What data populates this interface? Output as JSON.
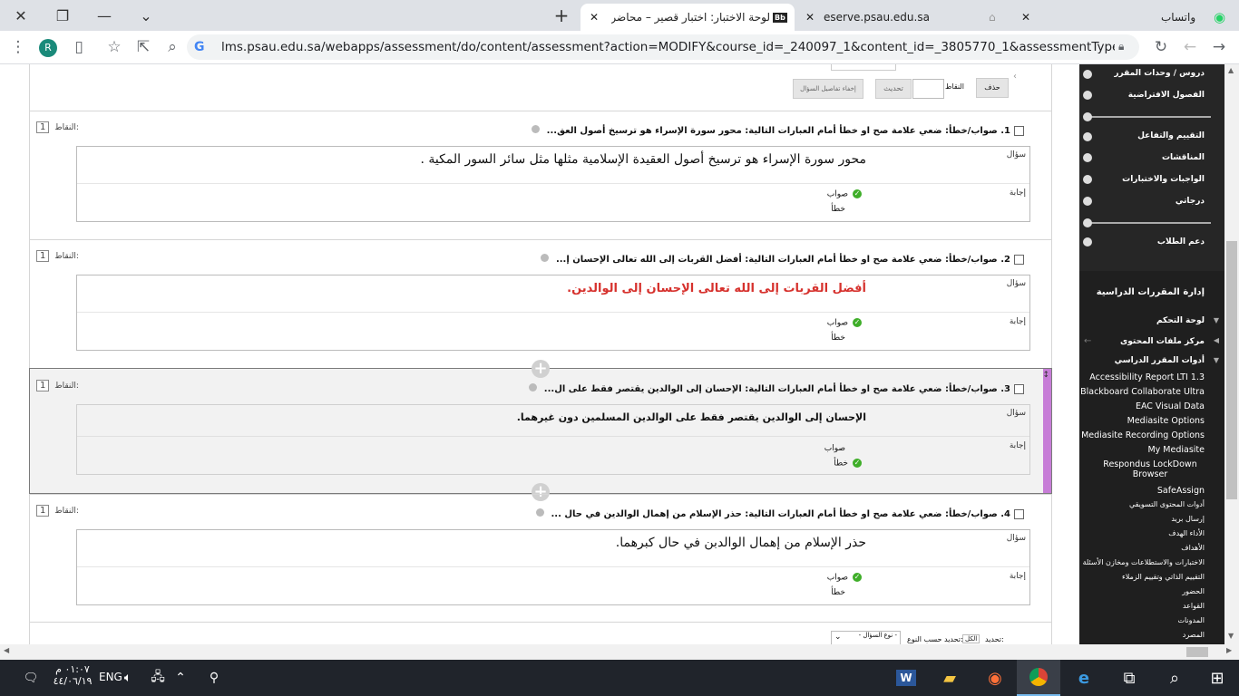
{
  "browser": {
    "tabs": [
      {
        "label": "لوحة الاختبار: اختبار قصير – محاضرة",
        "favicon": "Bb"
      },
      {
        "label": "eserve.psau.edu.sa"
      },
      {
        "label": "واتساب"
      }
    ],
    "url": "lms.psau.edu.sa/webapps/assessment/do/content/assessment?action=MODIFY&course_id=_240097_1&content_id=_3805770_1&assessmentType=Test&met...",
    "profile_initial": "R"
  },
  "toolbar": {
    "delete_label": "حذف",
    "points_label": "النقاط",
    "update_label": "تحديث",
    "hide_details_label": "إخفاء تفاصيل السؤال"
  },
  "questions": [
    {
      "number": "1.",
      "header": "صواب/خطأ: ضعي علامة صح او خطأ أمام العبارات التالية: محور سورة الإسراء هو ترسيخ  أصول العق...",
      "points_label": "النقاط:",
      "points": "1",
      "question_label": "سؤال",
      "question_text": "محور سورة الإسراء هو ترسيخ  أصول العقيدة الإسلامية مثلها مثل سائر السور المكية .",
      "answer_label": "إجابة",
      "answers": [
        "صواب",
        "خطأ"
      ],
      "correct": 0
    },
    {
      "number": "2.",
      "header": "صواب/خطأ: ضعي علامة صح او خطأ أمام العبارات التالية: أفضل القربات إلى الله تعالى الإحسان إ...",
      "points_label": "النقاط:",
      "points": "1",
      "question_label": "سؤال",
      "question_text": "أفضل القربات إلى الله تعالى الإحسان إلى الوالدين.",
      "answer_label": "إجابة",
      "answers": [
        "صواب",
        "خطأ"
      ],
      "correct": 0
    },
    {
      "number": "3.",
      "header": "صواب/خطأ: ضعي علامة صح او خطأ أمام العبارات التالية: الإحسان إلى الوالدين يقتصر فقط على ال...",
      "points_label": "النقاط:",
      "points": "1",
      "question_label": "سؤال",
      "question_text": "الإحسان إلى الوالدين يقتصر فقط على الوالدين المسلمين دون غيرهما.",
      "answer_label": "إجابة",
      "answers": [
        "صواب",
        "خطأ"
      ],
      "correct": 1
    },
    {
      "number": "4.",
      "header": "صواب/خطأ: ضعي علامة صح او خطأ أمام العبارات التالية: حذر الإسلام من إهمال الوالدين في حال ...",
      "points_label": "النقاط:",
      "points": "1",
      "question_label": "سؤال",
      "question_text": "حذر الإسلام من إهمال الوالدبن في حال كبرهما.",
      "answer_label": "إجابة",
      "answers": [
        "صواب",
        "خطأ"
      ],
      "correct": 0
    }
  ],
  "bottom_bar": {
    "select_label": "تحديد:",
    "all_label": "الكل",
    "select_by_type_label": "تحديد حسب النوع:",
    "type_select": "- نوع السؤال -"
  },
  "sidebar": {
    "top_items": [
      "دروس / وحدات المقرر",
      "الفصول الافتراضية",
      "التقييم والتفاعل",
      "المناقشات",
      "الواجبات والاختبارات",
      "درجاتي",
      "دعم الطلاب"
    ],
    "manage_title": "إدارة المقررات الدراسية",
    "control_panel": "لوحة التحكم",
    "content_files": "مركز ملفات المحتوى",
    "course_tools": "أدوات المقرر الدراسي",
    "tools": [
      "Accessibility Report LTI 1.3",
      "Blackboard Collaborate Ultra",
      "EAC Visual Data",
      "Mediasite Options",
      "Mediasite Recording Options",
      "My Mediasite",
      "Respondus LockDown Browser",
      "SafeAssign",
      "أدوات المحتوى التسويقي",
      "إرسال بريد",
      "الأداء الهدف",
      "الأهداف",
      "الاختبارات والاستطلاعات ومخازن الأسئلة",
      "التقييم الذاتي وتقييم الزملاء",
      "الحضور",
      "القواعد",
      "المدونات",
      "المصرد"
    ]
  },
  "taskbar": {
    "time": "٠١:٠٧ م",
    "date": "٤٤/٠٦/١٩",
    "language": "ENG"
  },
  "colors": {
    "accent_red": "#d6312d",
    "tick_green": "#3fae29",
    "selected_marker": "#c77dd7"
  }
}
